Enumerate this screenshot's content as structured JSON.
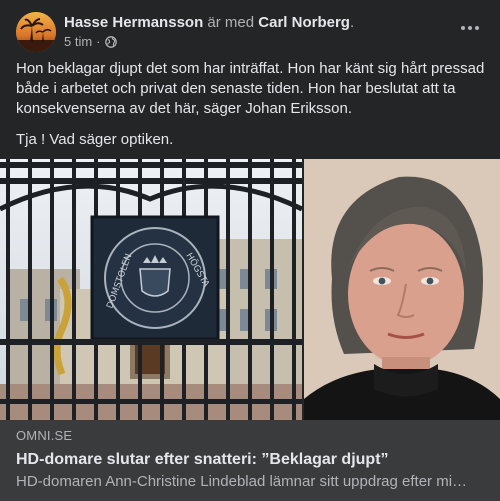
{
  "post": {
    "author": "Hasse Hermansson",
    "with_text": "är med",
    "tagged": "Carl Norberg",
    "trailing_punct": ".",
    "time": "5 tim",
    "dot": "·",
    "audience_icon": "globe-icon",
    "more_icon": "ellipsis-icon",
    "body_paragraphs": [
      "Hon beklagar djupt det som har inträffat. Hon har känt sig hårt pressad både i arbetet och privat den senaste tiden. Hon har beslutat att ta konsekvenserna av det här, säger Johan Eriksson.",
      "Tja ! Vad säger optiken."
    ]
  },
  "link_preview": {
    "domain": "OMNI.SE",
    "title": "HD-domare slutar efter snatteri: ”Beklagar djupt”",
    "description": "HD-domaren Ann-Christine Lindeblad lämnar sitt uppdrag efter mi…"
  },
  "images": {
    "left": "court-gate-photo",
    "right": "portrait-photo",
    "emblem_text": [
      "HÖGSTA",
      "DOMSTOLEN"
    ]
  },
  "colors": {
    "background": "#242526",
    "link_box": "#3a3b3c",
    "primary_text": "#e4e6eb",
    "secondary_text": "#b0b3b8"
  }
}
